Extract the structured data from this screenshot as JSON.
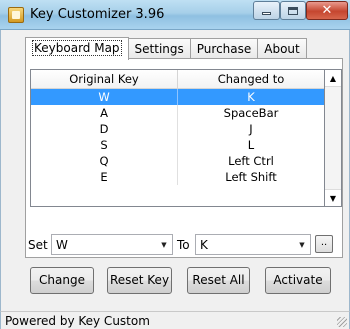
{
  "window": {
    "title": "Key Customizer 3.96"
  },
  "tabs": [
    {
      "label": "Keyboard Map",
      "active": true
    },
    {
      "label": "Settings"
    },
    {
      "label": "Purchase"
    },
    {
      "label": "About"
    }
  ],
  "table": {
    "headers": [
      "Original Key",
      "Changed to"
    ],
    "rows": [
      {
        "original": "W",
        "changed": "K",
        "selected": true
      },
      {
        "original": "A",
        "changed": "SpaceBar"
      },
      {
        "original": "D",
        "changed": "J"
      },
      {
        "original": "S",
        "changed": "L"
      },
      {
        "original": "Q",
        "changed": "Left Ctrl"
      },
      {
        "original": "E",
        "changed": "Left Shift"
      }
    ]
  },
  "mapping": {
    "set_label": "Set",
    "set_value": "W",
    "to_label": "To",
    "to_value": "K",
    "browse_label": ".."
  },
  "buttons": {
    "change": "Change",
    "reset_key": "Reset Key",
    "reset_all": "Reset All",
    "activate": "Activate"
  },
  "status": {
    "text": "Powered by Key Custom"
  },
  "colors": {
    "selection": "#3399ff",
    "titlebar": "#a6cfe9",
    "close_button": "#c5462f"
  }
}
